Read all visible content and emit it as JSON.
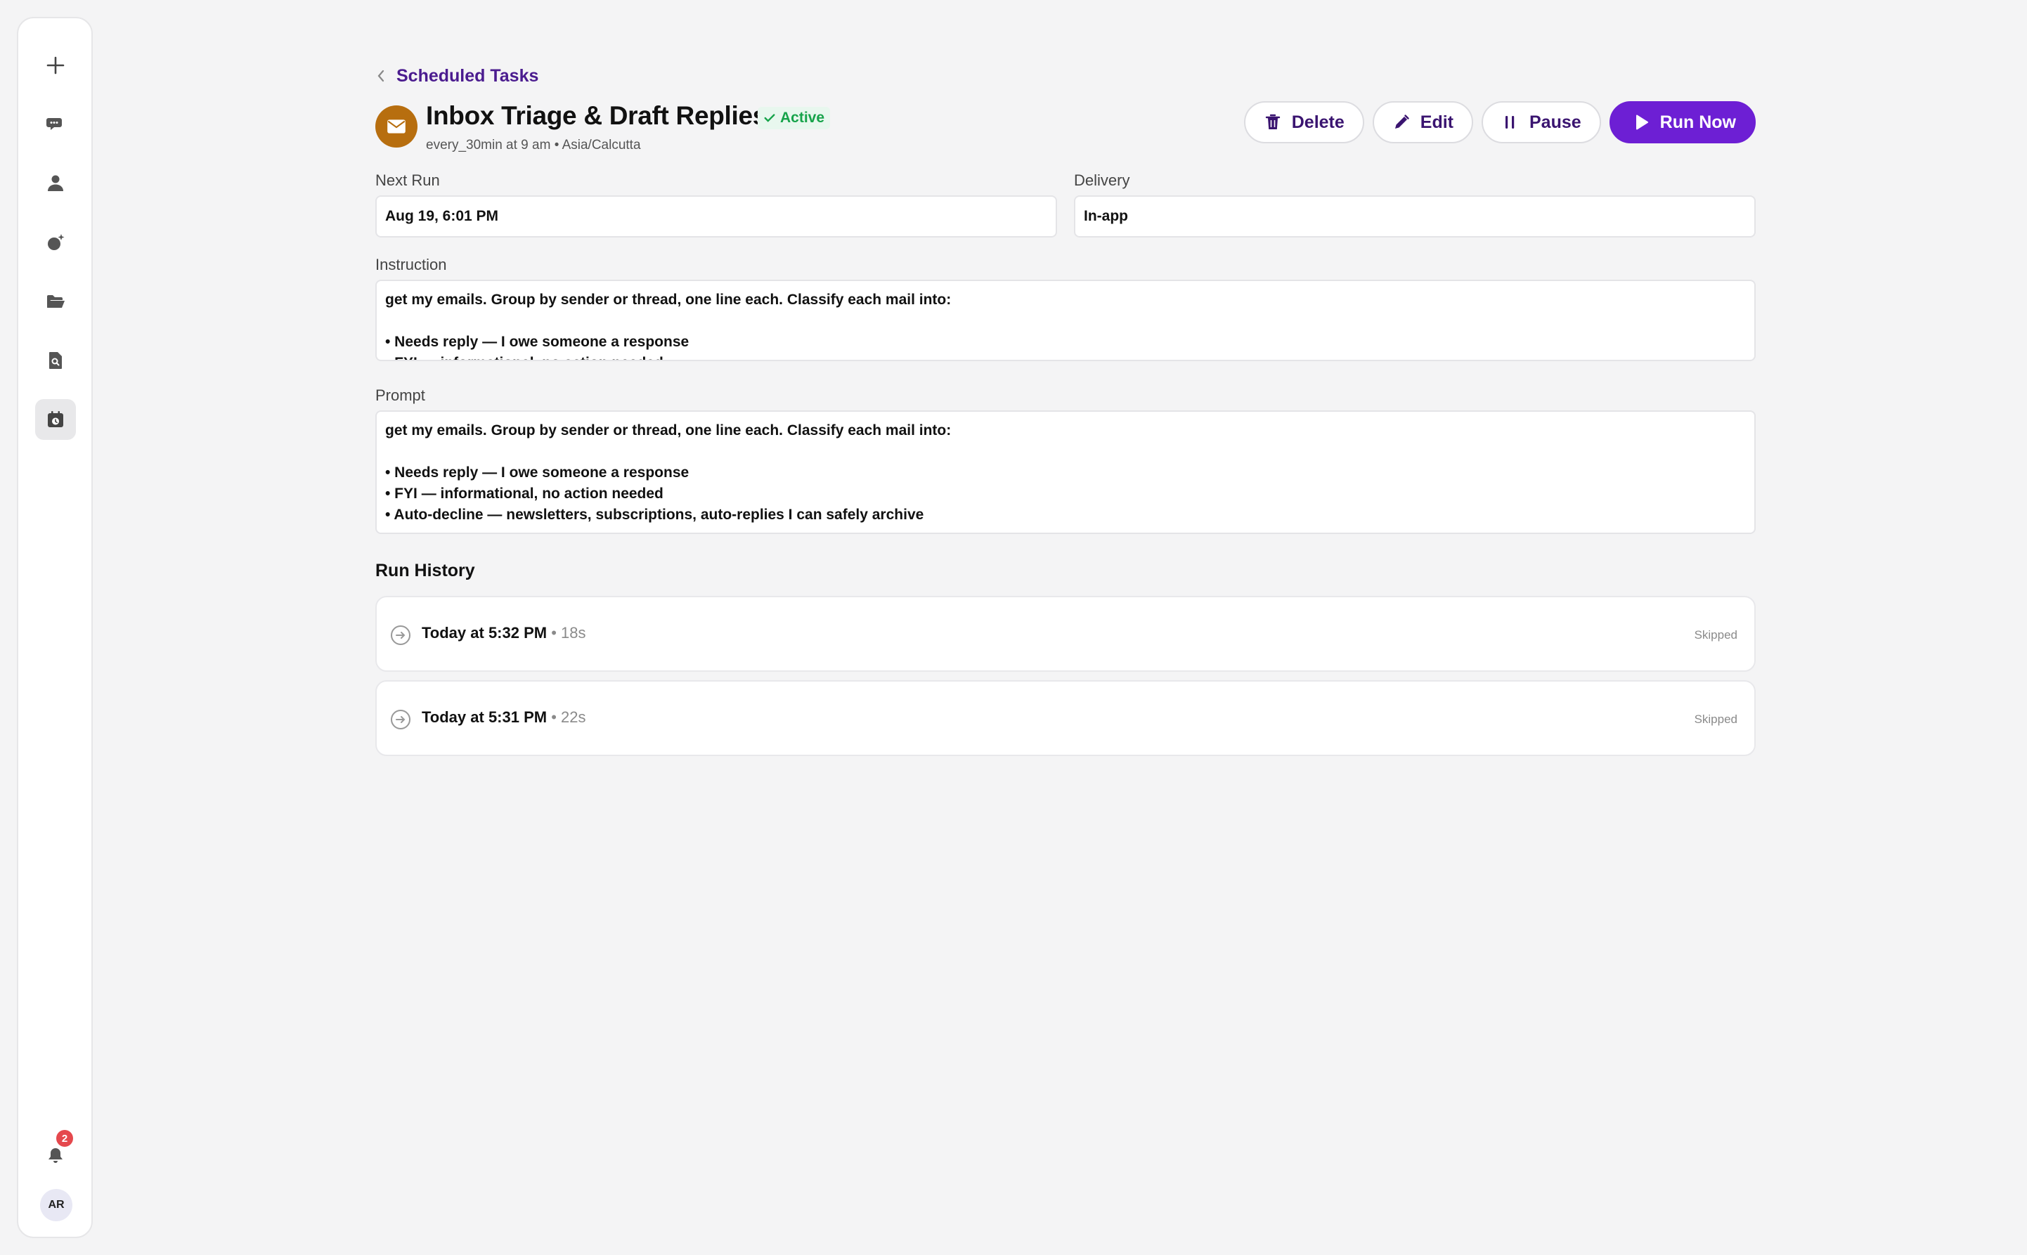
{
  "sidebar": {
    "items": [
      {
        "icon": "plus-icon"
      },
      {
        "icon": "chat-bubbles-icon"
      },
      {
        "icon": "person-icon"
      },
      {
        "icon": "agents-sparkle-icon"
      },
      {
        "icon": "folder-open-icon"
      },
      {
        "icon": "document-search-icon"
      },
      {
        "icon": "scheduled-calendar-icon",
        "active": true
      }
    ],
    "notifications_count": "2",
    "avatar_initials": "AR"
  },
  "breadcrumb": {
    "label": "Scheduled Tasks"
  },
  "task": {
    "title": "Inbox Triage & Draft Replies",
    "status": "Active",
    "schedule": "every_30min at 9 am • Asia/Calcutta",
    "icon": "envelope-icon",
    "icon_color": "#b76e0f"
  },
  "actions": {
    "delete_label": "Delete",
    "edit_label": "Edit",
    "pause_label": "Pause",
    "run_now_label": "Run Now"
  },
  "fields": {
    "next_run_label": "Next Run",
    "next_run_value": "Aug 19, 6:01 PM",
    "delivery_label": "Delivery",
    "delivery_value": "In-app",
    "instruction_label": "Instruction",
    "instruction_lines": [
      "get my emails. Group by sender or thread, one line each. Classify each mail into:",
      "",
      "• Needs reply — I owe someone a response",
      "• FYI — informational, no action needed"
    ],
    "prompt_label": "Prompt",
    "prompt_lines": [
      "get my emails. Group by sender or thread, one line each. Classify each mail into:",
      "",
      "• Needs reply — I owe someone a response",
      "• FYI — informational, no action needed",
      "• Auto-decline — newsletters, subscriptions, auto-replies I can safely archive"
    ]
  },
  "run_history": {
    "title": "Run History",
    "runs": [
      {
        "time": "Today at 5:32 PM",
        "duration": "• 18s",
        "status": "Skipped"
      },
      {
        "time": "Today at 5:31 PM",
        "duration": "• 22s",
        "status": "Skipped"
      }
    ]
  },
  "colors": {
    "accent": "#6d1fd4",
    "accent_text": "#3a1470",
    "active_green": "#16a34a",
    "badge_red": "#e5484d"
  }
}
